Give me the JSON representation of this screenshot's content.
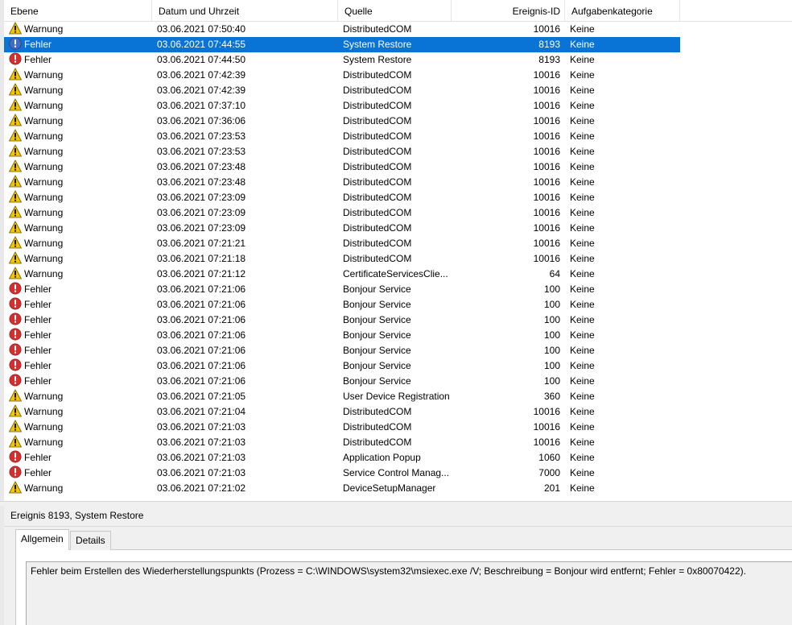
{
  "columns": {
    "level": "Ebene",
    "datetime": "Datum und Uhrzeit",
    "source": "Quelle",
    "event_id": "Ereignis-ID",
    "category": "Aufgabenkategorie"
  },
  "events": [
    {
      "level": "Warnung",
      "icon": "warning-icon",
      "datetime": "03.06.2021 07:50:40",
      "source": "DistributedCOM",
      "event_id": "10016",
      "category": "Keine"
    },
    {
      "level": "Fehler",
      "icon": "error-icon",
      "datetime": "03.06.2021 07:44:55",
      "source": "System Restore",
      "event_id": "8193",
      "category": "Keine",
      "selected": true
    },
    {
      "level": "Fehler",
      "icon": "error-icon",
      "datetime": "03.06.2021 07:44:50",
      "source": "System Restore",
      "event_id": "8193",
      "category": "Keine"
    },
    {
      "level": "Warnung",
      "icon": "warning-icon",
      "datetime": "03.06.2021 07:42:39",
      "source": "DistributedCOM",
      "event_id": "10016",
      "category": "Keine"
    },
    {
      "level": "Warnung",
      "icon": "warning-icon",
      "datetime": "03.06.2021 07:42:39",
      "source": "DistributedCOM",
      "event_id": "10016",
      "category": "Keine"
    },
    {
      "level": "Warnung",
      "icon": "warning-icon",
      "datetime": "03.06.2021 07:37:10",
      "source": "DistributedCOM",
      "event_id": "10016",
      "category": "Keine"
    },
    {
      "level": "Warnung",
      "icon": "warning-icon",
      "datetime": "03.06.2021 07:36:06",
      "source": "DistributedCOM",
      "event_id": "10016",
      "category": "Keine"
    },
    {
      "level": "Warnung",
      "icon": "warning-icon",
      "datetime": "03.06.2021 07:23:53",
      "source": "DistributedCOM",
      "event_id": "10016",
      "category": "Keine"
    },
    {
      "level": "Warnung",
      "icon": "warning-icon",
      "datetime": "03.06.2021 07:23:53",
      "source": "DistributedCOM",
      "event_id": "10016",
      "category": "Keine"
    },
    {
      "level": "Warnung",
      "icon": "warning-icon",
      "datetime": "03.06.2021 07:23:48",
      "source": "DistributedCOM",
      "event_id": "10016",
      "category": "Keine"
    },
    {
      "level": "Warnung",
      "icon": "warning-icon",
      "datetime": "03.06.2021 07:23:48",
      "source": "DistributedCOM",
      "event_id": "10016",
      "category": "Keine"
    },
    {
      "level": "Warnung",
      "icon": "warning-icon",
      "datetime": "03.06.2021 07:23:09",
      "source": "DistributedCOM",
      "event_id": "10016",
      "category": "Keine"
    },
    {
      "level": "Warnung",
      "icon": "warning-icon",
      "datetime": "03.06.2021 07:23:09",
      "source": "DistributedCOM",
      "event_id": "10016",
      "category": "Keine"
    },
    {
      "level": "Warnung",
      "icon": "warning-icon",
      "datetime": "03.06.2021 07:23:09",
      "source": "DistributedCOM",
      "event_id": "10016",
      "category": "Keine"
    },
    {
      "level": "Warnung",
      "icon": "warning-icon",
      "datetime": "03.06.2021 07:21:21",
      "source": "DistributedCOM",
      "event_id": "10016",
      "category": "Keine"
    },
    {
      "level": "Warnung",
      "icon": "warning-icon",
      "datetime": "03.06.2021 07:21:18",
      "source": "DistributedCOM",
      "event_id": "10016",
      "category": "Keine"
    },
    {
      "level": "Warnung",
      "icon": "warning-icon",
      "datetime": "03.06.2021 07:21:12",
      "source": "CertificateServicesClie...",
      "event_id": "64",
      "category": "Keine"
    },
    {
      "level": "Fehler",
      "icon": "error-icon",
      "datetime": "03.06.2021 07:21:06",
      "source": "Bonjour Service",
      "event_id": "100",
      "category": "Keine"
    },
    {
      "level": "Fehler",
      "icon": "error-icon",
      "datetime": "03.06.2021 07:21:06",
      "source": "Bonjour Service",
      "event_id": "100",
      "category": "Keine"
    },
    {
      "level": "Fehler",
      "icon": "error-icon",
      "datetime": "03.06.2021 07:21:06",
      "source": "Bonjour Service",
      "event_id": "100",
      "category": "Keine"
    },
    {
      "level": "Fehler",
      "icon": "error-icon",
      "datetime": "03.06.2021 07:21:06",
      "source": "Bonjour Service",
      "event_id": "100",
      "category": "Keine"
    },
    {
      "level": "Fehler",
      "icon": "error-icon",
      "datetime": "03.06.2021 07:21:06",
      "source": "Bonjour Service",
      "event_id": "100",
      "category": "Keine"
    },
    {
      "level": "Fehler",
      "icon": "error-icon",
      "datetime": "03.06.2021 07:21:06",
      "source": "Bonjour Service",
      "event_id": "100",
      "category": "Keine"
    },
    {
      "level": "Fehler",
      "icon": "error-icon",
      "datetime": "03.06.2021 07:21:06",
      "source": "Bonjour Service",
      "event_id": "100",
      "category": "Keine"
    },
    {
      "level": "Warnung",
      "icon": "warning-icon",
      "datetime": "03.06.2021 07:21:05",
      "source": "User Device Registration",
      "event_id": "360",
      "category": "Keine"
    },
    {
      "level": "Warnung",
      "icon": "warning-icon",
      "datetime": "03.06.2021 07:21:04",
      "source": "DistributedCOM",
      "event_id": "10016",
      "category": "Keine"
    },
    {
      "level": "Warnung",
      "icon": "warning-icon",
      "datetime": "03.06.2021 07:21:03",
      "source": "DistributedCOM",
      "event_id": "10016",
      "category": "Keine"
    },
    {
      "level": "Warnung",
      "icon": "warning-icon",
      "datetime": "03.06.2021 07:21:03",
      "source": "DistributedCOM",
      "event_id": "10016",
      "category": "Keine"
    },
    {
      "level": "Fehler",
      "icon": "error-icon",
      "datetime": "03.06.2021 07:21:03",
      "source": "Application Popup",
      "event_id": "1060",
      "category": "Keine"
    },
    {
      "level": "Fehler",
      "icon": "error-icon",
      "datetime": "03.06.2021 07:21:03",
      "source": "Service Control Manag...",
      "event_id": "7000",
      "category": "Keine"
    },
    {
      "level": "Warnung",
      "icon": "warning-icon",
      "datetime": "03.06.2021 07:21:02",
      "source": "DeviceSetupManager",
      "event_id": "201",
      "category": "Keine"
    }
  ],
  "detail": {
    "title": "Ereignis 8193, System Restore",
    "tabs": [
      "Allgemein",
      "Details"
    ],
    "active_tab": "Allgemein",
    "description": "Fehler beim Erstellen des Wiederherstellungspunkts (Prozess = C:\\WINDOWS\\system32\\msiexec.exe /V; Beschreibung = Bonjour wird entfernt; Fehler = 0x80070422)."
  },
  "colors": {
    "selection": "#0a73d6",
    "selection_icon": "#3b6fc9",
    "error": "#d32f2f",
    "warning": "#f5c400"
  }
}
